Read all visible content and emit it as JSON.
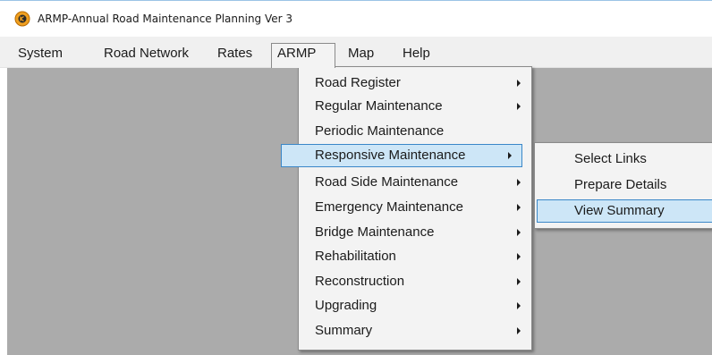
{
  "window": {
    "title": "ARMP-Annual Road Maintenance Planning Ver 3",
    "icon": "app-logo-icon",
    "accent_color": "#3a87c8",
    "workspace_color": "#ababab"
  },
  "menubar": {
    "items": [
      {
        "label": "System"
      },
      {
        "label": "Road Network"
      },
      {
        "label": "Rates"
      },
      {
        "label": "ARMP",
        "active": true
      },
      {
        "label": "Map"
      },
      {
        "label": "Help"
      }
    ]
  },
  "armp_menu": {
    "items": [
      {
        "label": "Road Register",
        "has_submenu": true
      },
      {
        "label": "Regular Maintenance",
        "has_submenu": true
      },
      {
        "label": "Periodic Maintenance",
        "has_submenu": false
      },
      {
        "label": "Responsive Maintenance",
        "has_submenu": true,
        "highlighted": true
      },
      {
        "label": "Road Side Maintenance",
        "has_submenu": true
      },
      {
        "label": "Emergency Maintenance",
        "has_submenu": true
      },
      {
        "label": "Bridge Maintenance",
        "has_submenu": true
      },
      {
        "label": "Rehabilitation",
        "has_submenu": true
      },
      {
        "label": "Reconstruction",
        "has_submenu": true
      },
      {
        "label": "Upgrading",
        "has_submenu": true
      },
      {
        "label": "Summary",
        "has_submenu": true
      }
    ]
  },
  "responsive_submenu": {
    "items": [
      {
        "label": "Select Links"
      },
      {
        "label": "Prepare Details"
      },
      {
        "label": "View Summary",
        "highlighted": true
      }
    ]
  }
}
